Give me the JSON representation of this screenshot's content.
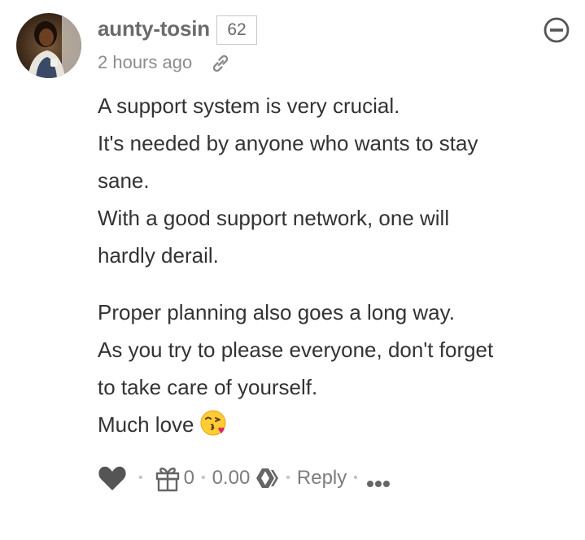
{
  "comment": {
    "author": "aunty-tosin",
    "reputation": "62",
    "timestamp": "2 hours ago",
    "body": {
      "paragraphs": [
        [
          "A support system is very crucial.",
          "It's needed by anyone who wants to stay",
          "sane.",
          "With a good support network, one will",
          "hardly derail."
        ],
        [
          "Proper planning also goes a long way.",
          "As you try to please everyone, don't forget",
          "to take care of yourself.",
          "Much love"
        ]
      ],
      "emoji": "face-blowing-kiss"
    },
    "footer": {
      "upvote_icon": "heart-icon",
      "gift_count": "0",
      "payout": "0.00",
      "currency_icon": "hive-icon",
      "reply_label": "Reply",
      "more_icon": "more-icon"
    }
  },
  "colors": {
    "text": "#333333",
    "muted": "#7d7d7d",
    "author": "#6b6b6b",
    "border": "#c8c8c8"
  }
}
